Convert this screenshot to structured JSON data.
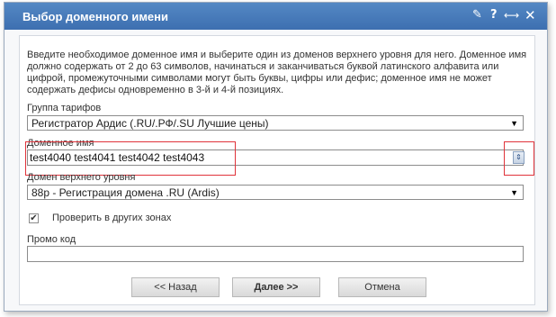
{
  "dialog": {
    "title": "Выбор доменного имени",
    "icons": [
      "broom-icon",
      "help-icon",
      "resize-icon",
      "close-icon"
    ]
  },
  "description": "Введите необходимое доменное имя и выберите один из доменов верхнего уровня для него. Доменное имя должно содержать от 2 до 63 символов, начинаться и заканчиваться буквой латинского алфавита или цифрой, промежуточными символами могут быть буквы, цифры или дефис; доменное имя не может содержать дефисы одновременно в 3-й и 4-й позициях.",
  "tariff_group": {
    "label": "Группа тарифов",
    "value": "Регистратор Ардис (.RU/.РФ/.SU Лучшие цены)"
  },
  "domain_name": {
    "label": "Доменное имя",
    "value": "test4040 test4041 test4042 test4043"
  },
  "tld": {
    "label": "Домен верхнего уровня",
    "value": "88р - Регистрация домена .RU (Ardis)"
  },
  "check_other_zones": {
    "label": "Проверить в других зонах",
    "checked": true
  },
  "promo": {
    "label": "Промо код",
    "value": ""
  },
  "buttons": {
    "back": "<< Назад",
    "next": "Далее >>",
    "cancel": "Отмена"
  },
  "colors": {
    "titlebar": "#4a7fbd",
    "highlight": "#e0333a"
  }
}
